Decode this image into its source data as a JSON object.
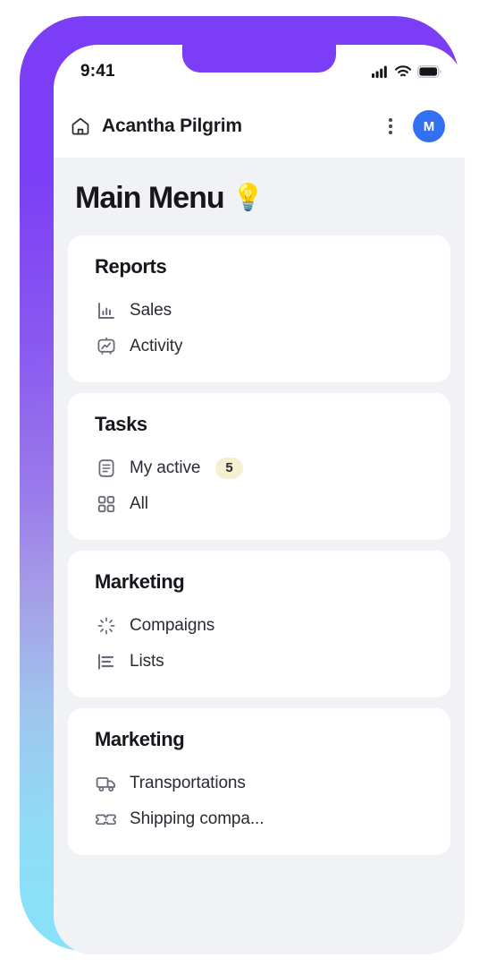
{
  "device": {
    "frame_gradient_top": "#7b3df5",
    "frame_gradient_bottom": "#86e3fb"
  },
  "status_bar": {
    "time": "9:41",
    "icons": [
      "cellular-signal-icon",
      "wifi-icon",
      "battery-icon"
    ]
  },
  "app_bar": {
    "home_icon": "home-icon",
    "title": "Acantha Pilgrim",
    "more_icon": "kebab-menu-icon",
    "avatar": {
      "initial": "M",
      "color": "#3170f0"
    }
  },
  "page": {
    "title": "Main Menu",
    "title_emoji": "💡",
    "background": "#f1f2f6"
  },
  "cards": [
    {
      "title": "Reports",
      "items": [
        {
          "icon": "bar-chart-icon",
          "label": "Sales"
        },
        {
          "icon": "activity-board-icon",
          "label": "Activity"
        }
      ]
    },
    {
      "title": "Tasks",
      "items": [
        {
          "icon": "document-icon",
          "label": "My active",
          "badge": "5",
          "badge_color": "#f6f0d2"
        },
        {
          "icon": "grid-icon",
          "label": "All"
        }
      ]
    },
    {
      "title": "Marketing",
      "items": [
        {
          "icon": "spinner-icon",
          "label": "Compaigns"
        },
        {
          "icon": "list-icon",
          "label": "Lists"
        }
      ]
    },
    {
      "title": "Marketing",
      "items": [
        {
          "icon": "truck-icon",
          "label": "Transportations"
        },
        {
          "icon": "ticket-icon",
          "label": "Shipping compa..."
        }
      ]
    }
  ]
}
